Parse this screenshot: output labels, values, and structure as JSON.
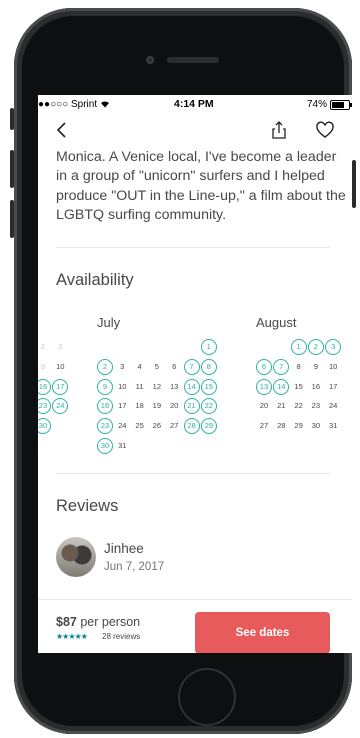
{
  "status": {
    "carrier": "●●○○○ Sprint",
    "time": "4:14 PM",
    "battery": "74%"
  },
  "bio": {
    "text": "Monica. A Venice local, I've become a leader in a group of \"unicorn\" surfers and I helped produce \"OUT in the Line-up,\" a film about the LGBTQ surfing community."
  },
  "availability": {
    "title": "Availability",
    "months": [
      {
        "name": "July"
      },
      {
        "name": "August"
      }
    ]
  },
  "reviews": {
    "title": "Reviews",
    "items": [
      {
        "name": "Jinhee",
        "date": "Jun 7, 2017"
      }
    ]
  },
  "footer": {
    "price_amount": "$87",
    "price_suffix": " per person",
    "stars": "★★★★★",
    "review_count": "28 reviews",
    "cta": "See dates"
  },
  "colors": {
    "accent": "#2bb3a3",
    "cta": "#e85b5d",
    "text": "#484848"
  },
  "icons": [
    "back-chevron-icon",
    "share-icon",
    "heart-icon",
    "wifi-icon",
    "battery-icon"
  ]
}
